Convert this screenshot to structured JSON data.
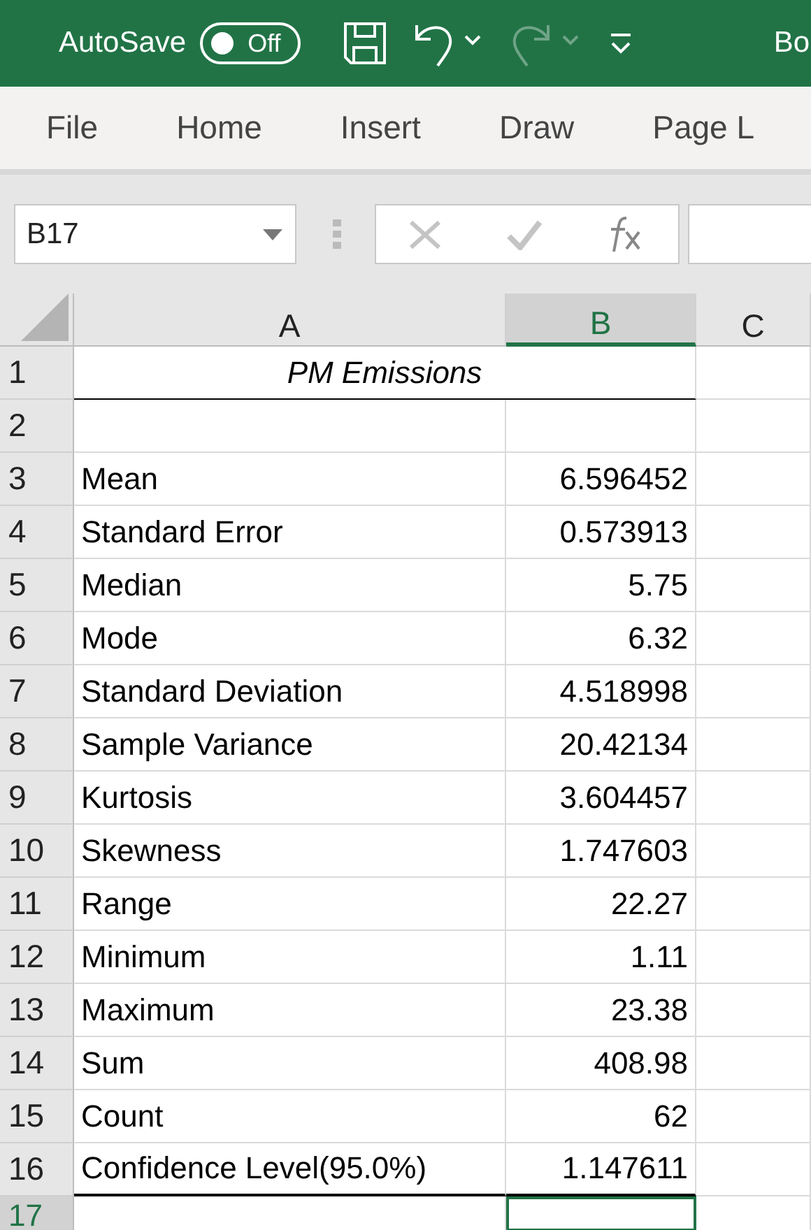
{
  "title_bar": {
    "autosave_label": "AutoSave",
    "autosave_toggle": {
      "text": "Off",
      "on": false
    },
    "quick_access": [
      {
        "kind": "save",
        "disabled": false
      },
      {
        "kind": "undo",
        "disabled": false
      },
      {
        "kind": "redo",
        "disabled": true
      },
      {
        "kind": "customize",
        "disabled": false
      }
    ],
    "document_title": "Bo"
  },
  "ribbon_tabs": [
    {
      "label": "File",
      "selected": false
    },
    {
      "label": "Home",
      "selected": false
    },
    {
      "label": "Insert",
      "selected": false
    },
    {
      "label": "Draw",
      "selected": false
    },
    {
      "label": "Page L",
      "selected": false
    }
  ],
  "formula_bar": {
    "name_box": "B17"
  },
  "sheet": {
    "columns": [
      {
        "label": "A",
        "selected": false
      },
      {
        "label": "B",
        "selected": true
      },
      {
        "label": "C",
        "selected": false
      }
    ],
    "rows": [
      {
        "number": "1",
        "selected": false,
        "kind": "title",
        "label": "PM Emissions"
      },
      {
        "number": "2",
        "selected": false,
        "kind": "stat",
        "label": "",
        "value": ""
      },
      {
        "number": "3",
        "selected": false,
        "kind": "stat",
        "label": "Mean",
        "value": "6.596452"
      },
      {
        "number": "4",
        "selected": false,
        "kind": "stat",
        "label": "Standard Error",
        "value": "0.573913"
      },
      {
        "number": "5",
        "selected": false,
        "kind": "stat",
        "label": "Median",
        "value": "5.75"
      },
      {
        "number": "6",
        "selected": false,
        "kind": "stat",
        "label": "Mode",
        "value": "6.32"
      },
      {
        "number": "7",
        "selected": false,
        "kind": "stat",
        "label": "Standard Deviation",
        "value": "4.518998"
      },
      {
        "number": "8",
        "selected": false,
        "kind": "stat",
        "label": "Sample Variance",
        "value": "20.42134"
      },
      {
        "number": "9",
        "selected": false,
        "kind": "stat",
        "label": "Kurtosis",
        "value": "3.604457"
      },
      {
        "number": "10",
        "selected": false,
        "kind": "stat",
        "label": "Skewness",
        "value": "1.747603"
      },
      {
        "number": "11",
        "selected": false,
        "kind": "stat",
        "label": "Range",
        "value": "22.27"
      },
      {
        "number": "12",
        "selected": false,
        "kind": "stat",
        "label": "Minimum",
        "value": "1.11"
      },
      {
        "number": "13",
        "selected": false,
        "kind": "stat",
        "label": "Maximum",
        "value": "23.38"
      },
      {
        "number": "14",
        "selected": false,
        "kind": "stat",
        "label": "Sum",
        "value": "408.98"
      },
      {
        "number": "15",
        "selected": false,
        "kind": "stat",
        "label": "Count",
        "value": "62"
      },
      {
        "number": "16",
        "selected": false,
        "kind": "stat",
        "label": "Confidence Level(95.0%)",
        "value": "1.147611",
        "bottom_border": true
      },
      {
        "number": "17",
        "selected": true,
        "kind": "stat",
        "label": "",
        "value": "",
        "active_cell": true
      }
    ]
  }
}
